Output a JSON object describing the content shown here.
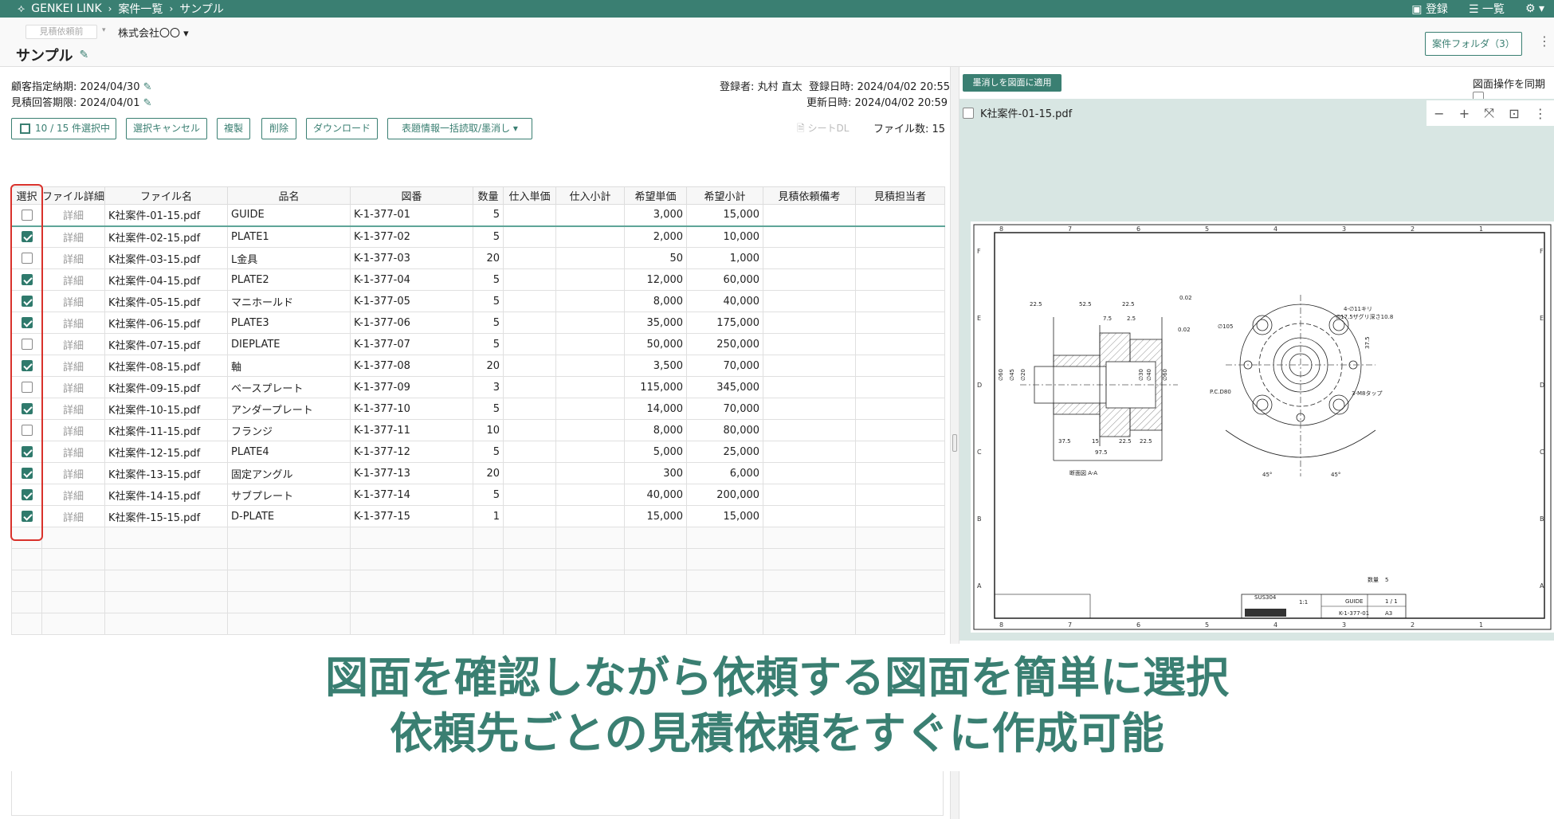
{
  "topbar": {
    "crumbs": [
      "GENKEI LINK",
      "案件一覧",
      "サンプル"
    ],
    "register": "登録",
    "list": "一覧",
    "settings": "⚙"
  },
  "header": {
    "status": "見積依頼前",
    "company": "株式会社〇〇",
    "title": "サンプル",
    "folder_button": "案件フォルダ（3）"
  },
  "meta": {
    "customer_deadline_label": "顧客指定納期:",
    "customer_deadline": "2024/04/30",
    "quote_deadline_label": "見積回答期限:",
    "quote_deadline": "2024/04/01",
    "registrant_label": "登録者:",
    "registrant": "丸村 直太",
    "registered_label": "登録日時:",
    "registered": "2024/04/02 20:55",
    "updated_label": "更新日時:",
    "updated": "2024/04/02 20:59"
  },
  "toolbar": {
    "select_count": "10 / 15 件選択中",
    "cancel_selection": "選択キャンセル",
    "duplicate": "複製",
    "delete": "削除",
    "download": "ダウンロード",
    "bulk_read": "表題情報一括読取/墨消し",
    "sheet_dl": "シートDL",
    "file_count": "ファイル数: 15"
  },
  "table": {
    "headers": [
      "選択",
      "ファイル詳細",
      "ファイル名",
      "品名",
      "図番",
      "数量",
      "仕入単価",
      "仕入小計",
      "希望単価",
      "希望小計",
      "見積依頼備考",
      "見積担当者"
    ],
    "detail_label": "詳細",
    "rows": [
      {
        "checked": false,
        "file": "K社案件-01-15.pdf",
        "name": "GUIDE",
        "drawing": "K-1-377-01",
        "qty": "5",
        "unit": "3,000",
        "subtotal": "15,000"
      },
      {
        "checked": true,
        "file": "K社案件-02-15.pdf",
        "name": "PLATE1",
        "drawing": "K-1-377-02",
        "qty": "5",
        "unit": "2,000",
        "subtotal": "10,000"
      },
      {
        "checked": false,
        "file": "K社案件-03-15.pdf",
        "name": "L金具",
        "drawing": "K-1-377-03",
        "qty": "20",
        "unit": "50",
        "subtotal": "1,000"
      },
      {
        "checked": true,
        "file": "K社案件-04-15.pdf",
        "name": "PLATE2",
        "drawing": "K-1-377-04",
        "qty": "5",
        "unit": "12,000",
        "subtotal": "60,000"
      },
      {
        "checked": true,
        "file": "K社案件-05-15.pdf",
        "name": "マニホールド",
        "drawing": "K-1-377-05",
        "qty": "5",
        "unit": "8,000",
        "subtotal": "40,000"
      },
      {
        "checked": true,
        "file": "K社案件-06-15.pdf",
        "name": "PLATE3",
        "drawing": "K-1-377-06",
        "qty": "5",
        "unit": "35,000",
        "subtotal": "175,000"
      },
      {
        "checked": false,
        "file": "K社案件-07-15.pdf",
        "name": "DIEPLATE",
        "drawing": "K-1-377-07",
        "qty": "5",
        "unit": "50,000",
        "subtotal": "250,000"
      },
      {
        "checked": true,
        "file": "K社案件-08-15.pdf",
        "name": "軸",
        "drawing": "K-1-377-08",
        "qty": "20",
        "unit": "3,500",
        "subtotal": "70,000"
      },
      {
        "checked": false,
        "file": "K社案件-09-15.pdf",
        "name": "ベースプレート",
        "drawing": "K-1-377-09",
        "qty": "3",
        "unit": "115,000",
        "subtotal": "345,000"
      },
      {
        "checked": true,
        "file": "K社案件-10-15.pdf",
        "name": "アンダープレート",
        "drawing": "K-1-377-10",
        "qty": "5",
        "unit": "14,000",
        "subtotal": "70,000"
      },
      {
        "checked": false,
        "file": "K社案件-11-15.pdf",
        "name": "フランジ",
        "drawing": "K-1-377-11",
        "qty": "10",
        "unit": "8,000",
        "subtotal": "80,000"
      },
      {
        "checked": true,
        "file": "K社案件-12-15.pdf",
        "name": "PLATE4",
        "drawing": "K-1-377-12",
        "qty": "5",
        "unit": "5,000",
        "subtotal": "25,000"
      },
      {
        "checked": true,
        "file": "K社案件-13-15.pdf",
        "name": "固定アングル",
        "drawing": "K-1-377-13",
        "qty": "20",
        "unit": "300",
        "subtotal": "6,000"
      },
      {
        "checked": true,
        "file": "K社案件-14-15.pdf",
        "name": "サブプレート",
        "drawing": "K-1-377-14",
        "qty": "5",
        "unit": "40,000",
        "subtotal": "200,000"
      },
      {
        "checked": true,
        "file": "K社案件-15-15.pdf",
        "name": "D-PLATE",
        "drawing": "K-1-377-15",
        "qty": "1",
        "unit": "15,000",
        "subtotal": "15,000"
      }
    ]
  },
  "viewer": {
    "apply_button": "墨消しを図面に適用",
    "sync_label": "図面操作を同期",
    "file_name": "K社案件-01-15.pdf",
    "zoom_controls": [
      "−",
      "+",
      "⤧",
      "⊡",
      "⋮"
    ],
    "drawing": {
      "section_label": "断面図 A-A",
      "part_name": "GUIDE",
      "drawing_no": "K-1-377-01",
      "qty_label": "数量",
      "qty": "5",
      "size": "A3",
      "material": "SUS304",
      "scale": "1:1",
      "sheet": "1 / 1",
      "col_nums": [
        "8",
        "7",
        "6",
        "5",
        "4",
        "3",
        "2",
        "1"
      ],
      "row_letters": [
        "F",
        "E",
        "D",
        "C",
        "B",
        "A"
      ],
      "dims": [
        "22.5",
        "52.5",
        "22.5",
        "7.5",
        "2.5",
        "37.5",
        "15",
        "22.5",
        "22.5",
        "97.5",
        "45°",
        "45°",
        "0.02",
        "0.02",
        "4-∅11キリ",
        "∅17.5ザグリ深さ10.8",
        "P.C.D80",
        "3-M8タップ",
        "∅105",
        "∅60",
        "∅45",
        "∅20",
        "∅30",
        "∅40",
        "∅60",
        "37.5"
      ]
    }
  },
  "caption": {
    "line1": "図面を確認しながら依頼する図面を簡単に選択",
    "line2": "依頼先ごとの見積依頼をすぐに作成可能"
  }
}
